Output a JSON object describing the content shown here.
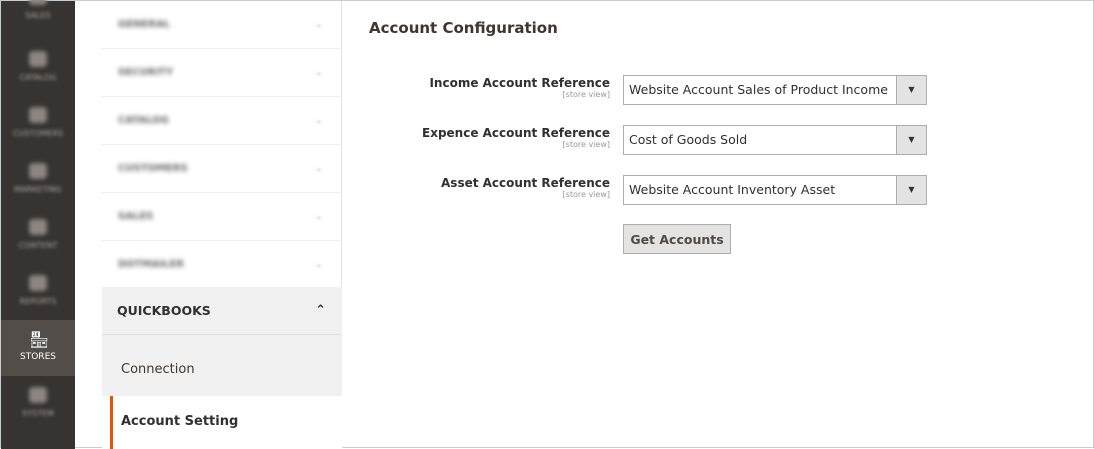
{
  "admin_menu": [
    {
      "label": "SALES"
    },
    {
      "label": "CATALOG"
    },
    {
      "label": "CUSTOMERS"
    },
    {
      "label": "MARKETING"
    },
    {
      "label": "CONTENT"
    },
    {
      "label": "REPORTS"
    },
    {
      "label": "STORES",
      "active": true
    },
    {
      "label": "SYSTEM"
    }
  ],
  "config_nav": {
    "sections": [
      "GENERAL",
      "SECURITY",
      "CATALOG",
      "CUSTOMERS",
      "SALES",
      "DOTMAILER"
    ],
    "open_section": "QUICKBOOKS",
    "items": [
      "Connection",
      "Account Setting"
    ],
    "active_item": "Account Setting"
  },
  "main": {
    "title": "Account Configuration",
    "fields": [
      {
        "label": "Income Account Reference",
        "scope": "[store view]",
        "value": "Website Account Sales of Product Income"
      },
      {
        "label": "Expence Account Reference",
        "scope": "[store view]",
        "value": "Cost of Goods Sold"
      },
      {
        "label": "Asset Account Reference",
        "scope": "[store view]",
        "value": "Website Account Inventory Asset"
      }
    ],
    "button": "Get Accounts"
  },
  "colors": {
    "accent": "#eb5202",
    "admin_bg": "#373330"
  }
}
